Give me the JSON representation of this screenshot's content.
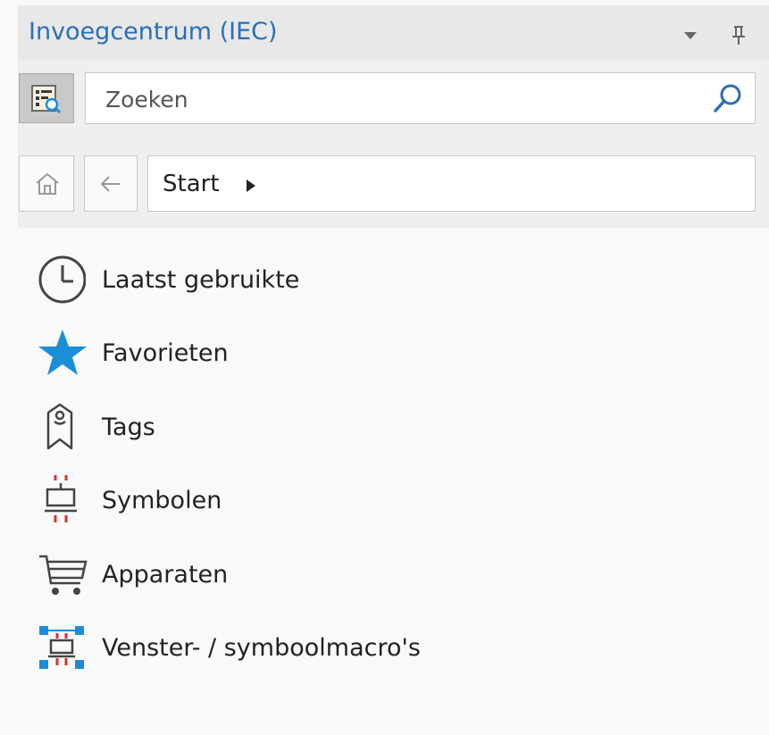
{
  "panel": {
    "title": "Invoegcentrum (IEC)",
    "accent_color": "#2a6ebb",
    "title_actions": [
      "dropdown-icon",
      "pin-icon"
    ]
  },
  "search": {
    "placeholder": "Zoeken",
    "value": "",
    "filter_icon": "filter-list-icon",
    "search_icon": "search-icon"
  },
  "navigation": {
    "home_icon": "home-icon",
    "back_icon": "back-arrow-icon",
    "breadcrumb": "Start",
    "breadcrumb_arrow_icon": "caret-right-icon"
  },
  "items": [
    {
      "label": "Laatst gebruikte",
      "icon": "clock-icon"
    },
    {
      "label": "Favorieten",
      "icon": "star-icon",
      "icon_color": "#1a8fd8"
    },
    {
      "label": "Tags",
      "icon": "tag-icon"
    },
    {
      "label": "Symbolen",
      "icon": "symbol-icon",
      "icon_color": "#d9312b"
    },
    {
      "label": "Apparaten",
      "icon": "cart-icon"
    },
    {
      "label": "Venster- / symboolmacro's",
      "icon": "macro-icon",
      "icon_color": "#1a8fd8"
    }
  ]
}
